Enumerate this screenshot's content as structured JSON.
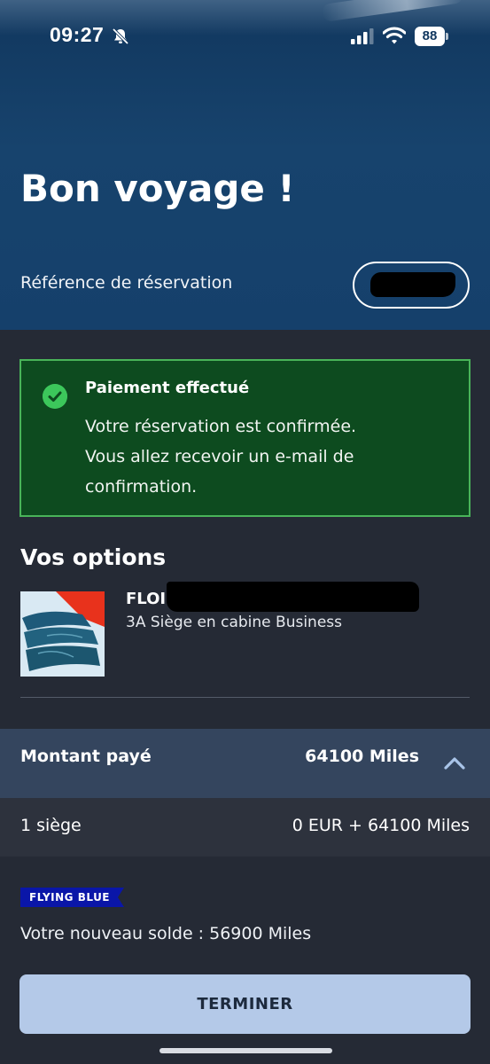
{
  "status_bar": {
    "time": "09:27",
    "battery": "88",
    "icons": [
      "bell-slash-icon",
      "cellular-signal-icon",
      "wifi-icon",
      "battery-icon"
    ]
  },
  "hero": {
    "title": "Bon voyage !",
    "booking_reference_label": "Référence de réservation"
  },
  "alert": {
    "title": "Paiement effectué",
    "lines": [
      "Votre réservation est confirmée.",
      "Vous allez recevoir un e-mail de",
      "confirmation."
    ],
    "icon": "check-circle-icon",
    "color": "#0d4b1f",
    "border_color": "#49b459"
  },
  "options": {
    "title": "Vos options",
    "item": {
      "name": "FLOI",
      "description": "3A Siège en cabine Business"
    }
  },
  "payment": {
    "label": "Montant payé",
    "amount": "64100 Miles",
    "detail_label": "1 siège",
    "detail_value": "0 EUR + 64100 Miles"
  },
  "loyalty": {
    "badge": "FLYING BLUE",
    "balance_text": "Votre nouveau solde : 56900 Miles"
  },
  "actions": {
    "finish_label": "TERMINER"
  }
}
